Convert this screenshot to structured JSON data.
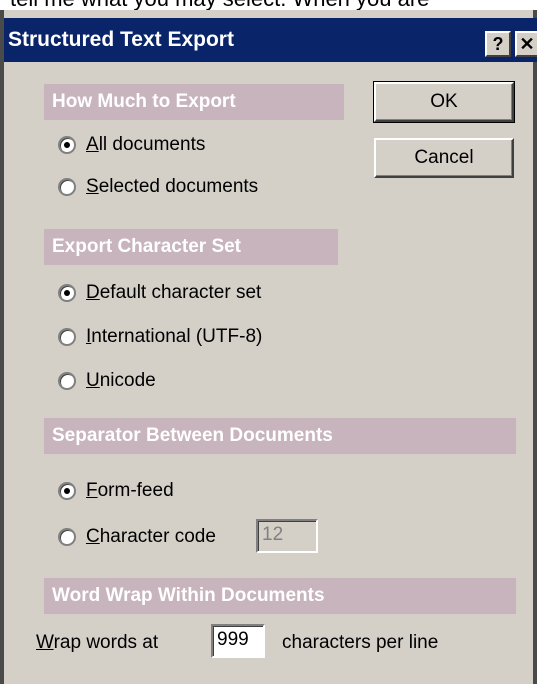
{
  "background_fragment": "tell me what you may select. When you are",
  "window": {
    "title": "Structured Text Export",
    "help_label": "?",
    "close_label": "✕"
  },
  "buttons": {
    "ok": "OK",
    "cancel": "Cancel"
  },
  "sections": [
    {
      "header": "How Much to Export",
      "options": [
        {
          "label": "All documents",
          "mnemonic": "A",
          "checked": true
        },
        {
          "label": "Selected documents",
          "mnemonic": "S",
          "checked": false
        }
      ]
    },
    {
      "header": "Export Character Set",
      "options": [
        {
          "label": "Default character set",
          "mnemonic": "D",
          "checked": true
        },
        {
          "label": "International (UTF-8)",
          "mnemonic": "I",
          "checked": false
        },
        {
          "label": "Unicode",
          "mnemonic": "U",
          "checked": false
        }
      ]
    },
    {
      "header": "Separator Between Documents",
      "options": [
        {
          "label": "Form-feed",
          "mnemonic": "F",
          "checked": true
        },
        {
          "label": "Character code",
          "mnemonic": "C",
          "checked": false
        }
      ],
      "character_code_value": "12"
    },
    {
      "header": "Word Wrap Within Documents",
      "wrap_prefix": "Wrap words at",
      "wrap_mnemonic": "W",
      "wrap_value": "999",
      "wrap_suffix": "characters per line"
    }
  ]
}
